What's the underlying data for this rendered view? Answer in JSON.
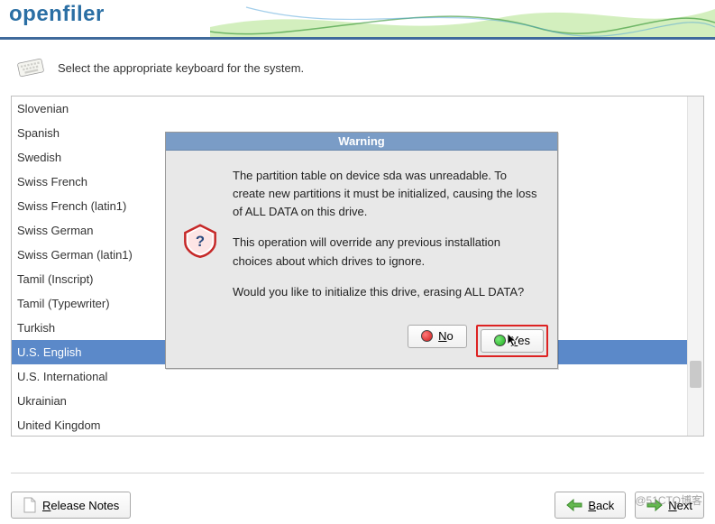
{
  "header": {
    "logo_text": "openfiler"
  },
  "instruction": "Select the appropriate keyboard for the system.",
  "keyboard_list": [
    "Slovenian",
    "Spanish",
    "Swedish",
    "Swiss French",
    "Swiss French (latin1)",
    "Swiss German",
    "Swiss German (latin1)",
    "Tamil (Inscript)",
    "Tamil (Typewriter)",
    "Turkish",
    "U.S. English",
    "U.S. International",
    "Ukrainian",
    "United Kingdom"
  ],
  "selected_index": 10,
  "scrollbar": {
    "thumb_top_pct": 78,
    "thumb_height_pct": 8
  },
  "dialog": {
    "title": "Warning",
    "para1": "The partition table on device sda was unreadable. To create new partitions it must be initialized, causing the loss of ALL DATA on this drive.",
    "para2": "This operation will override any previous installation choices about which drives to ignore.",
    "para3": "Would you like to initialize this drive, erasing ALL DATA?",
    "no_label": "No",
    "yes_label": "Yes"
  },
  "footer": {
    "release_notes": "Release Notes",
    "back": "Back",
    "next": "Next"
  },
  "watermark": "@51CTO博客"
}
